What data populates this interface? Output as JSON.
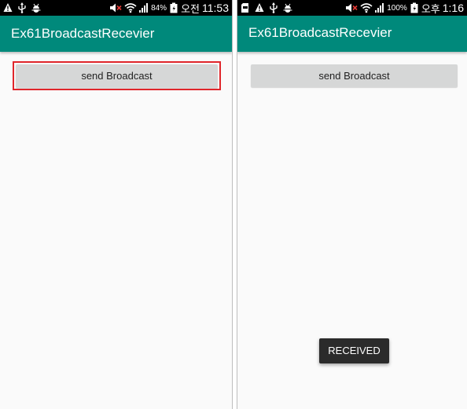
{
  "screens": [
    {
      "status_bar": {
        "icons_left": [
          "warning-icon",
          "usb-icon",
          "android-debug-icon"
        ],
        "icons_right": [
          "volume-mute-icon",
          "wifi-icon",
          "signal-icon"
        ],
        "battery": "84%",
        "ampm": "오전",
        "time": "11:53"
      },
      "title": "Ex61BroadcastRecevier",
      "button_label": "send Broadcast",
      "highlight_color": "#e0262b"
    },
    {
      "status_bar": {
        "icons_left": [
          "sd-card-icon",
          "warning-icon",
          "usb-icon",
          "android-debug-icon"
        ],
        "icons_right": [
          "volume-mute-icon",
          "wifi-icon",
          "signal-icon"
        ],
        "battery": "100%",
        "ampm": "오후",
        "time": "1:16"
      },
      "title": "Ex61BroadcastRecevier",
      "button_label": "send Broadcast",
      "toast": "RECEIVED"
    }
  ],
  "colors": {
    "action_bar": "#00897b",
    "status_bar": "#000000",
    "background": "#fafafa",
    "button": "#d6d7d7",
    "toast": "#2b2b2b"
  }
}
